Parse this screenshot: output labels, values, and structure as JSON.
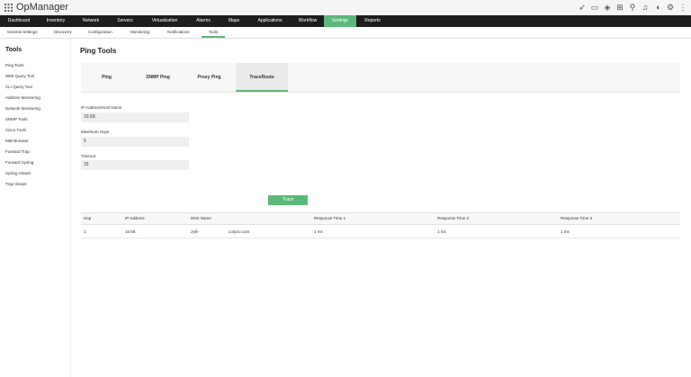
{
  "app": {
    "title": "OpManager"
  },
  "main_nav": [
    {
      "label": "Dashboard",
      "active": false
    },
    {
      "label": "Inventory",
      "active": false
    },
    {
      "label": "Network",
      "active": false
    },
    {
      "label": "Servers",
      "active": false
    },
    {
      "label": "Virtualization",
      "active": false
    },
    {
      "label": "Alarms",
      "active": false
    },
    {
      "label": "Maps",
      "active": false
    },
    {
      "label": "Applications",
      "active": false
    },
    {
      "label": "Workflow",
      "active": false
    },
    {
      "label": "Settings",
      "active": true
    },
    {
      "label": "Reports",
      "active": false
    }
  ],
  "sub_nav": [
    {
      "label": "General Settings"
    },
    {
      "label": "Discovery"
    },
    {
      "label": "Configuration"
    },
    {
      "label": "Monitoring"
    },
    {
      "label": "Notifications"
    },
    {
      "label": "Tools"
    }
  ],
  "sidebar": {
    "title": "Tools",
    "items": [
      {
        "label": "Ping Tools"
      },
      {
        "label": "WMI Query Tool"
      },
      {
        "label": "CLI Query Tool"
      },
      {
        "label": "Address Monitoring"
      },
      {
        "label": "Network Monitoring"
      },
      {
        "label": "SNMP Tools"
      },
      {
        "label": "Cisco Tools"
      },
      {
        "label": "MIB Browser"
      },
      {
        "label": "Forward Trap"
      },
      {
        "label": "Forward Syslog"
      },
      {
        "label": "Syslog Viewer"
      },
      {
        "label": "Trap Viewer"
      }
    ]
  },
  "content": {
    "title": "Ping Tools",
    "tabs": [
      {
        "label": "Ping"
      },
      {
        "label": "SNMP Ping"
      },
      {
        "label": "Proxy Ping"
      },
      {
        "label": "TraceRoute"
      }
    ],
    "form": {
      "ip_label": "IP Address/Host Name",
      "ip_value": "10.59.",
      "hops_label": "Maximum Hops",
      "hops_value": "5",
      "timeout_label": "Timeout",
      "timeout_value": "15"
    },
    "trace_button": "Trace",
    "table": {
      "headers": [
        "Hop",
        "IP Address",
        "DNS Name",
        "Response Time 1",
        "Response Time 2",
        "Response Time 3"
      ],
      "rows": [
        {
          "hop": "1",
          "ip": "10.59.",
          "dns_a": "zylli-",
          "dns_b": "corpzo.com",
          "rt1": "1 ms",
          "rt2": "1 ms",
          "rt3": "1 ms"
        }
      ]
    }
  },
  "icons": [
    "grid-icon",
    "rocket-icon",
    "monitor-icon",
    "chip-icon",
    "gift-icon",
    "search-icon",
    "bell-icon",
    "megaphone-icon",
    "gear-icon",
    "more-icon"
  ],
  "colors": {
    "accent": "#5cb87a",
    "nav_bg": "#1d1d1d"
  }
}
